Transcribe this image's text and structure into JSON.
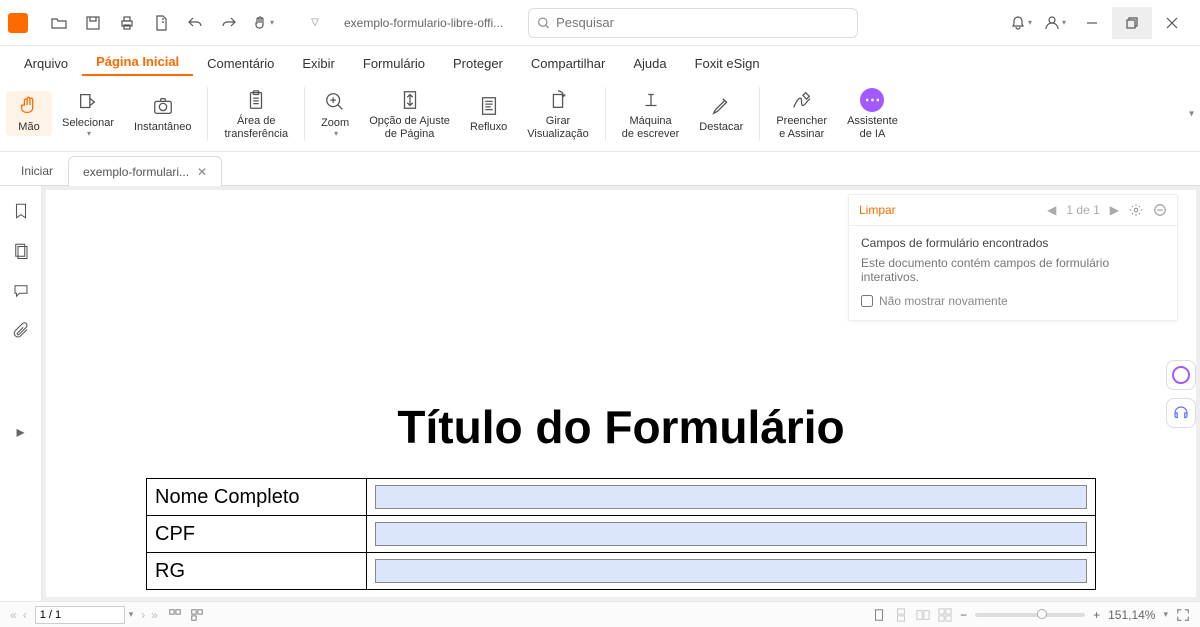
{
  "titlebar": {
    "address": "exemplo-formulario-libre-offi...",
    "search_placeholder": "Pesquisar"
  },
  "menu": {
    "items": [
      "Arquivo",
      "Página Inicial",
      "Comentário",
      "Exibir",
      "Formulário",
      "Proteger",
      "Compartilhar",
      "Ajuda",
      "Foxit eSign"
    ],
    "active_index": 1
  },
  "ribbon": {
    "mao": "Mão",
    "selecionar": "Selecionar",
    "instantaneo": "Instantâneo",
    "area": "Área de\ntransferência",
    "zoom": "Zoom",
    "ajuste": "Opção de Ajuste\nde Página",
    "refluxo": "Refluxo",
    "girar": "Girar\nVisualização",
    "maquina": "Máquina\nde escrever",
    "destacar": "Destacar",
    "preencher": "Preencher\ne Assinar",
    "assistente": "Assistente\nde IA"
  },
  "tabs": {
    "t1": "Iniciar",
    "t2": "exemplo-formulari..."
  },
  "panel": {
    "clear": "Limpar",
    "page_text": "1 de 1",
    "title": "Campos de formulário encontrados",
    "body": "Este documento contém campos de formulário interativos.",
    "dont_show": "Não mostrar novamente"
  },
  "doc": {
    "title": "Título do Formulário",
    "rows": [
      "Nome Completo",
      "CPF",
      "RG"
    ]
  },
  "status": {
    "page": "1 / 1",
    "zoom": "151,14%"
  }
}
